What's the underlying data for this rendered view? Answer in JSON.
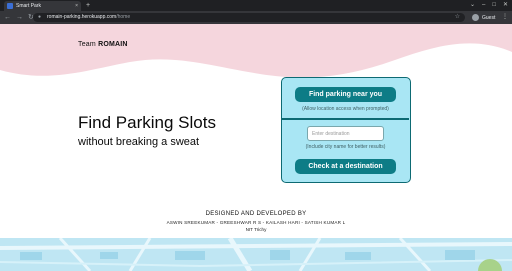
{
  "browser": {
    "tab_title": "Smart Park",
    "tab_close": "×",
    "new_tab": "+",
    "url_host": "romain-parking.herokuapp.com",
    "url_path": "/home",
    "profile_name": "Guest"
  },
  "header": {
    "team_prefix": "Team",
    "team_name": "ROMAIN"
  },
  "hero": {
    "title": "Find Parking Slots",
    "subtitle": "without breaking a sweat"
  },
  "card": {
    "find_button": "Find parking near you",
    "find_hint": "(Allow location access when prompted)",
    "destination_placeholder": "Enter destination",
    "destination_value": "",
    "destination_hint": "(Include city name for better results)",
    "check_button": "Check at a destination"
  },
  "credits": {
    "title": "DESIGNED AND DEVELOPED BY",
    "names": "ASWIN SREEKUMAR - GREESHWAR R S - KAILASH HARI - SATISH KUMAR L",
    "institution": "NIT Trichy"
  },
  "colors": {
    "wave_pink": "#f5d6dd",
    "card_bg": "#a9e6f4",
    "button_teal": "#0d7c86",
    "map_blue": "#bfe6f3"
  },
  "icons": {
    "back": "back-arrow-icon",
    "forward": "forward-arrow-icon",
    "reload": "reload-icon",
    "lock": "lock-icon",
    "star": "star-icon",
    "menu": "menu-dots-icon"
  }
}
